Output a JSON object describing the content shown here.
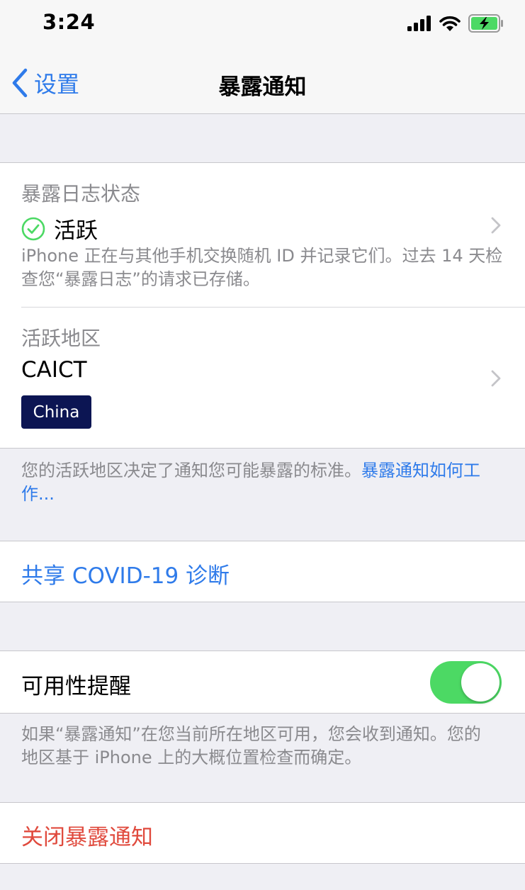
{
  "status_bar": {
    "time": "3:24",
    "icons": [
      "cellular-signal-icon",
      "wifi-icon",
      "battery-charging-icon"
    ]
  },
  "nav": {
    "back_label": "设置",
    "title": "暴露通知"
  },
  "exposure_log": {
    "label": "暴露日志状态",
    "status": "活跃",
    "status_icon": "checkmark-circle-icon",
    "description": "iPhone 正在与其他手机交换随机 ID 并记录它们。过去 14 天检查您“暴露日志”的请求已存储。"
  },
  "active_region": {
    "label": "活跃地区",
    "value": "CAICT",
    "badge": "China"
  },
  "region_footer": {
    "text": "您的活跃地区决定了通知您可能暴露的标准。",
    "link": "暴露通知如何工作..."
  },
  "share_diagnosis": {
    "label": "共享 COVID-19 诊断"
  },
  "availability_alerts": {
    "label": "可用性提醒",
    "enabled": true,
    "footer": "如果“暴露通知”在您当前所在地区可用，您会收到通知。您的地区基于 iPhone 上的大概位置检查而确定。"
  },
  "turn_off": {
    "label": "关闭暴露通知"
  },
  "colors": {
    "accent": "#2f7bea",
    "toggle_on": "#4cd964",
    "destructive": "#e04a3d",
    "active_check": "#4cd964",
    "badge_bg": "#0c1553"
  }
}
